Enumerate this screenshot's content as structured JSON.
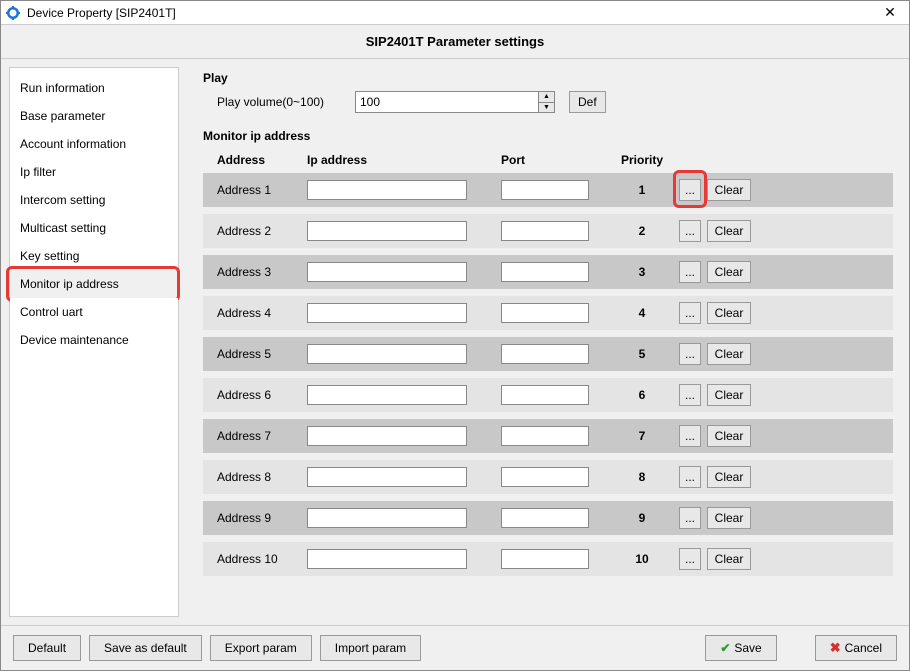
{
  "window": {
    "title": "Device Property [SIP2401T]",
    "subtitle": "SIP2401T Parameter settings"
  },
  "sidebar": {
    "items": [
      {
        "label": "Run information"
      },
      {
        "label": "Base parameter"
      },
      {
        "label": "Account information"
      },
      {
        "label": "Ip filter"
      },
      {
        "label": "Intercom setting"
      },
      {
        "label": "Multicast setting"
      },
      {
        "label": "Key setting"
      },
      {
        "label": "Monitor ip address",
        "active": true
      },
      {
        "label": "Control uart"
      },
      {
        "label": "Device maintenance"
      }
    ]
  },
  "play": {
    "section_title": "Play",
    "volume_label": "Play volume(0~100)",
    "volume_value": "100",
    "def_label": "Def"
  },
  "monitor": {
    "section_title": "Monitor ip address",
    "headers": {
      "address": "Address",
      "ip": "Ip address",
      "port": "Port",
      "priority": "Priority"
    },
    "dots_label": "...",
    "clear_label": "Clear",
    "rows": [
      {
        "label": "Address 1",
        "ip": "",
        "port": "",
        "priority": "1",
        "dark": true,
        "highlight_dots": true
      },
      {
        "label": "Address 2",
        "ip": "",
        "port": "",
        "priority": "2",
        "dark": false
      },
      {
        "label": "Address 3",
        "ip": "",
        "port": "",
        "priority": "3",
        "dark": true
      },
      {
        "label": "Address 4",
        "ip": "",
        "port": "",
        "priority": "4",
        "dark": false
      },
      {
        "label": "Address 5",
        "ip": "",
        "port": "",
        "priority": "5",
        "dark": true
      },
      {
        "label": "Address 6",
        "ip": "",
        "port": "",
        "priority": "6",
        "dark": false
      },
      {
        "label": "Address 7",
        "ip": "",
        "port": "",
        "priority": "7",
        "dark": true
      },
      {
        "label": "Address 8",
        "ip": "",
        "port": "",
        "priority": "8",
        "dark": false
      },
      {
        "label": "Address 9",
        "ip": "",
        "port": "",
        "priority": "9",
        "dark": true
      },
      {
        "label": "Address 10",
        "ip": "",
        "port": "",
        "priority": "10",
        "dark": false
      }
    ]
  },
  "footer": {
    "default": "Default",
    "save_as_default": "Save as default",
    "export": "Export param",
    "import": "Import param",
    "save": "Save",
    "cancel": "Cancel"
  }
}
